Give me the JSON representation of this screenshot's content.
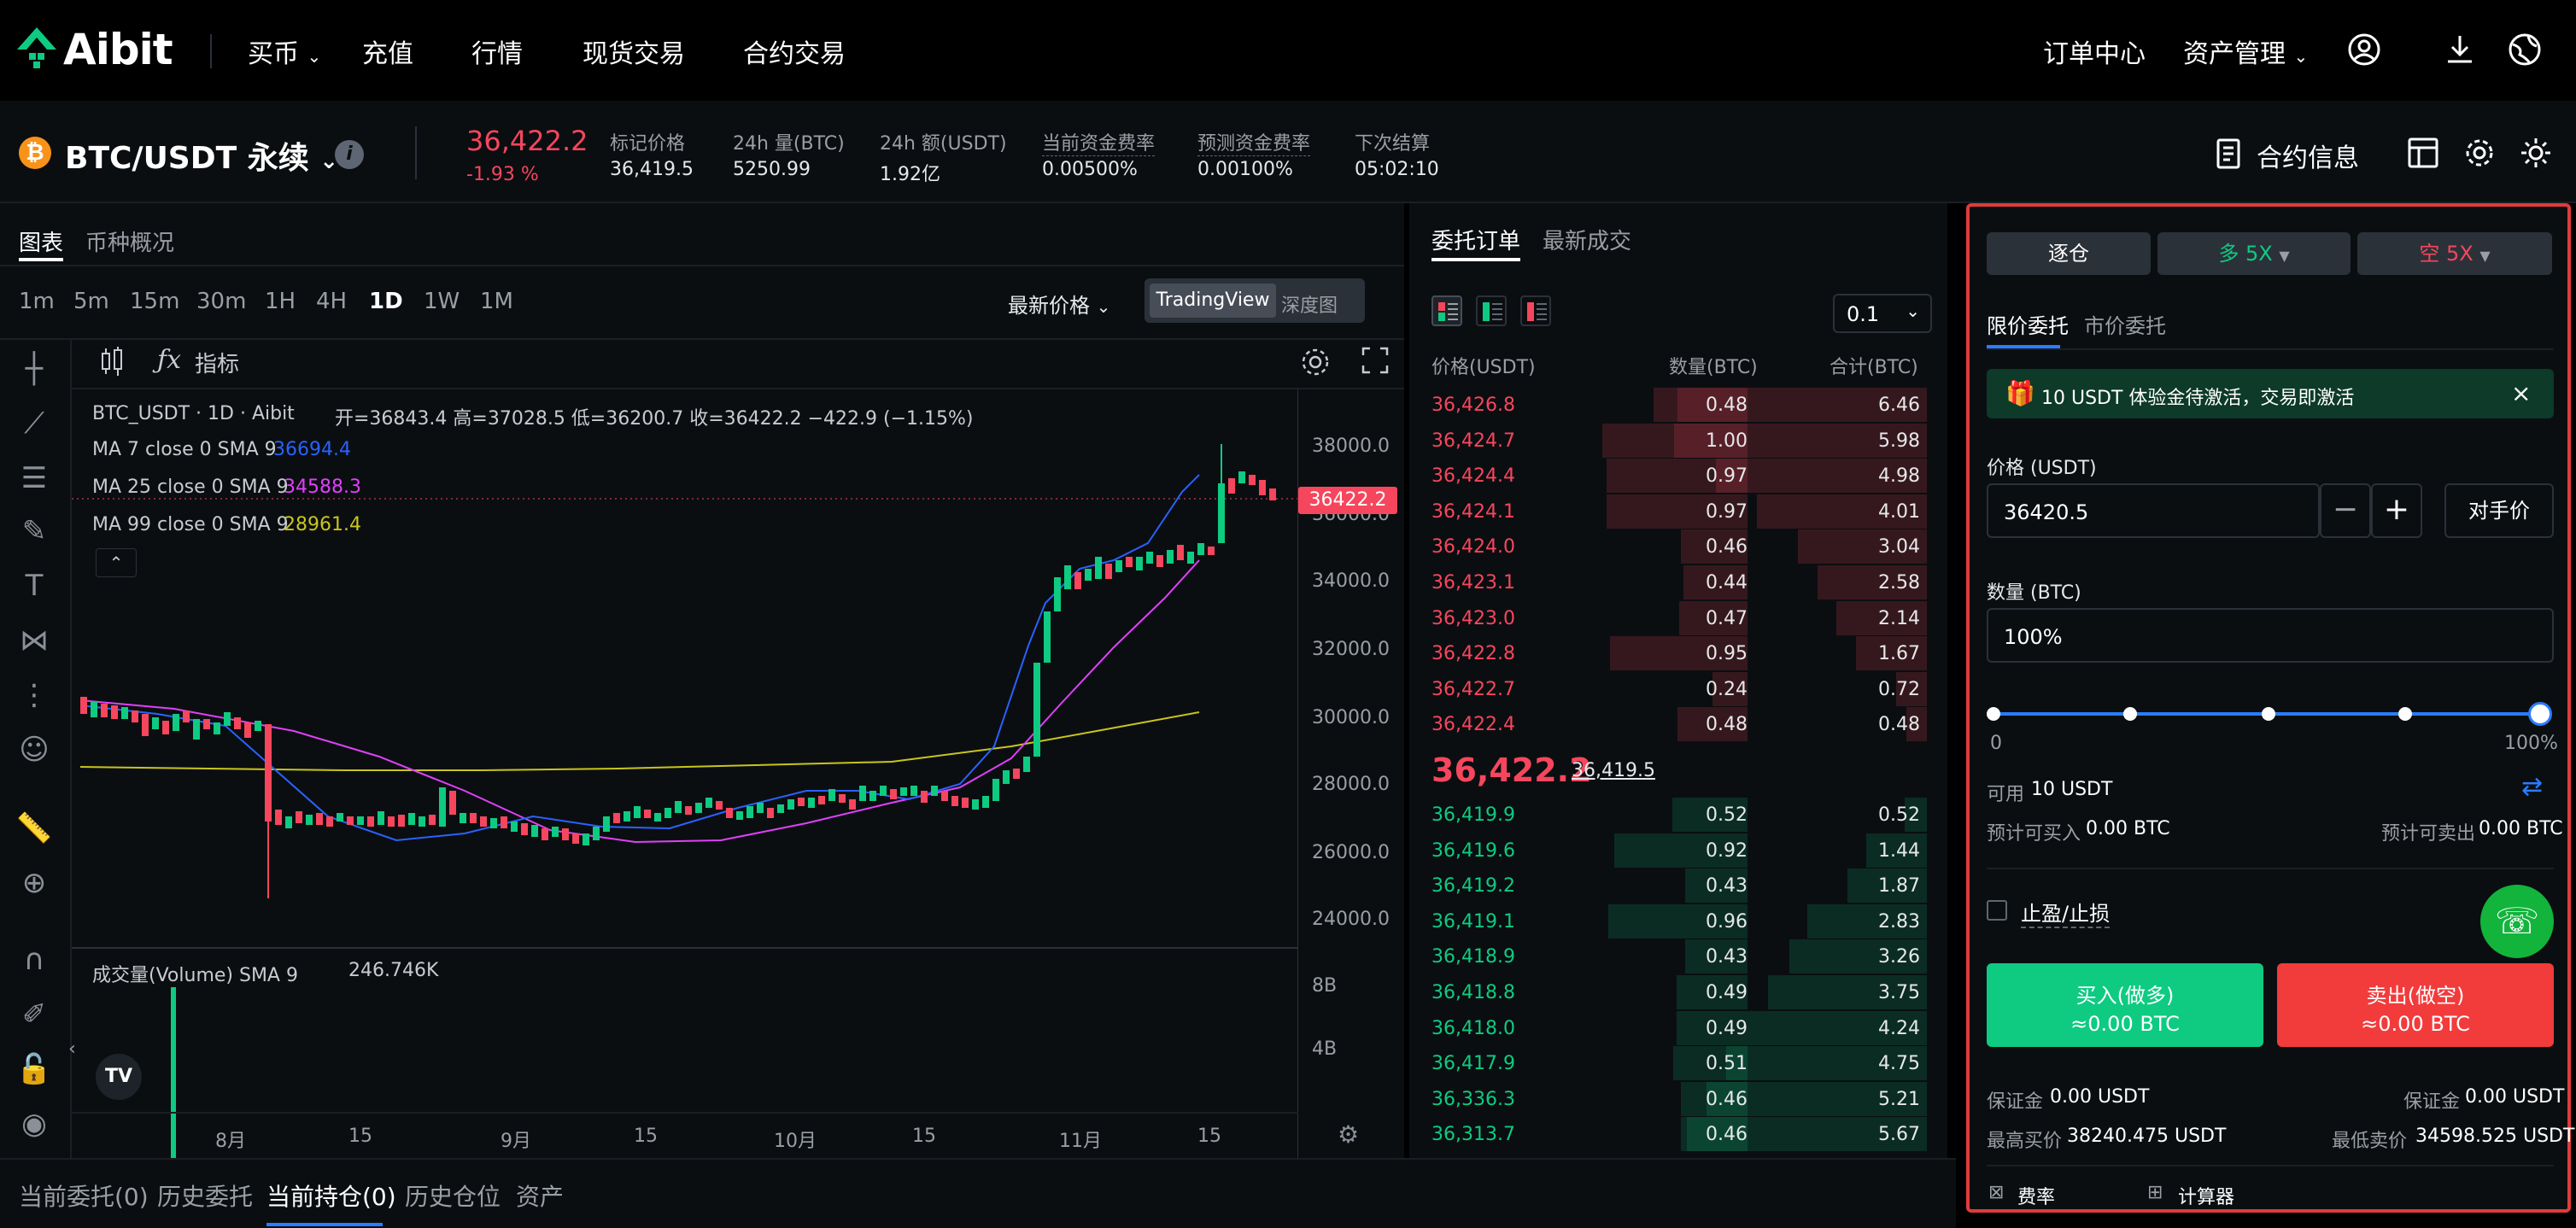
{
  "nav": {
    "logo": "Aibit",
    "items": [
      "买币",
      "充值",
      "行情",
      "现货交易",
      "合约交易"
    ],
    "right": [
      "订单中心",
      "资产管理"
    ]
  },
  "ticker": {
    "symbol": "BTC/USDT 永续",
    "price": "36,422.2",
    "change": "-1.93 %",
    "stats": [
      {
        "label": "标记价格",
        "value": "36,419.5"
      },
      {
        "label": "24h 量(BTC)",
        "value": "5250.99"
      },
      {
        "label": "24h 额(USDT)",
        "value": "1.92亿"
      },
      {
        "label": "当前资金费率",
        "value": "0.00500%"
      },
      {
        "label": "预测资金费率",
        "value": "0.00100%"
      },
      {
        "label": "下次结算",
        "value": "05:02:10"
      }
    ],
    "contract_info": "合约信息"
  },
  "chart": {
    "tabs": [
      "图表",
      "币种概况"
    ],
    "timeframes": [
      "1m",
      "5m",
      "15m",
      "30m",
      "1H",
      "4H",
      "1D",
      "1W",
      "1M"
    ],
    "active_tf": "1D",
    "price_type": "最新价格",
    "views": [
      "TradingView",
      "深度图"
    ],
    "indicators_label": "指标",
    "ohlc_title": "BTC_USDT · 1D · Aibit",
    "ohlc": "开=36843.4 高=37028.5 低=36200.7 收=36422.2 −422.9 (−1.15%)",
    "ma": [
      {
        "label": "MA 7 close 0 SMA 9",
        "value": "36694.4",
        "color": "#2962ff"
      },
      {
        "label": "MA 25 close 0 SMA 9",
        "value": "34588.3",
        "color": "#e040fb"
      },
      {
        "label": "MA 99 close 0 SMA 9",
        "value": "28961.4",
        "color": "#c9c51c"
      }
    ],
    "volume_label": "成交量(Volume) SMA 9",
    "volume_value": "246.746K",
    "price_tag": "36422.2",
    "y_ticks": [
      "38000.0",
      "36000.0",
      "34000.0",
      "32000.0",
      "30000.0",
      "28000.0",
      "26000.0",
      "24000.0"
    ],
    "vol_ticks": [
      "8B",
      "4B"
    ],
    "x_ticks": [
      "8月",
      "15",
      "9月",
      "15",
      "10月",
      "15",
      "11月",
      "15"
    ]
  },
  "orderbook": {
    "tabs": [
      "委托订单",
      "最新成交"
    ],
    "precision": "0.1",
    "headers": [
      "价格(USDT)",
      "数量(BTC)",
      "合计(BTC)"
    ],
    "asks": [
      [
        "36,426.8",
        "0.48",
        "6.46"
      ],
      [
        "36,424.7",
        "1.00",
        "5.98"
      ],
      [
        "36,424.4",
        "0.97",
        "4.98"
      ],
      [
        "36,424.1",
        "0.97",
        "4.01"
      ],
      [
        "36,424.0",
        "0.46",
        "3.04"
      ],
      [
        "36,423.1",
        "0.44",
        "2.58"
      ],
      [
        "36,423.0",
        "0.47",
        "2.14"
      ],
      [
        "36,422.8",
        "0.95",
        "1.67"
      ],
      [
        "36,422.7",
        "0.24",
        "0.72"
      ],
      [
        "36,422.4",
        "0.48",
        "0.48"
      ]
    ],
    "last_price": "36,422.2",
    "mark_price": "36,419.5",
    "bids": [
      [
        "36,419.9",
        "0.52",
        "0.52"
      ],
      [
        "36,419.6",
        "0.92",
        "1.44"
      ],
      [
        "36,419.2",
        "0.43",
        "1.87"
      ],
      [
        "36,419.1",
        "0.96",
        "2.83"
      ],
      [
        "36,418.9",
        "0.43",
        "3.26"
      ],
      [
        "36,418.8",
        "0.49",
        "3.75"
      ],
      [
        "36,418.0",
        "0.49",
        "4.24"
      ],
      [
        "36,417.9",
        "0.51",
        "4.75"
      ],
      [
        "36,336.3",
        "0.46",
        "5.21"
      ],
      [
        "36,313.7",
        "0.46",
        "5.67"
      ]
    ]
  },
  "trade": {
    "margin_mode": "逐仓",
    "long_lev": "多 5X",
    "short_lev": "空 5X",
    "order_tabs": [
      "限价委托",
      "市价委托"
    ],
    "promo": "10 USDT 体验金待激活，交易即激活",
    "price_label": "价格 (USDT)",
    "price_value": "36420.5",
    "counter_price": "对手价",
    "qty_label": "数量 (BTC)",
    "qty_value": "100%",
    "slider_min": "0",
    "slider_max": "100%",
    "slider_level": 1.0,
    "available_label": "可用",
    "available_value": "10 USDT",
    "est_buy_label": "预计可买入",
    "est_buy_value": "0.00 BTC",
    "est_sell_label": "预计可卖出",
    "est_sell_value": "0.00 BTC",
    "tpsl": "止盈/止损",
    "buy_label": "买入(做多)",
    "buy_sub": "≈0.00 BTC",
    "sell_label": "卖出(做空)",
    "sell_sub": "≈0.00 BTC",
    "margin_label": "保证金",
    "margin_buy": "0.00 USDT",
    "margin_sell": "0.00 USDT",
    "max_buy_label": "最高买价",
    "max_buy": "38240.475 USDT",
    "min_sell_label": "最低卖价",
    "min_sell": "34598.525 USDT",
    "fee_label": "费率",
    "calc_label": "计算器"
  },
  "bottom_tabs": [
    "当前委托(0)",
    "历史委托",
    "当前持仓(0)",
    "历史仓位",
    "资产"
  ],
  "colors": {
    "up": "#0ecb81",
    "down": "#f6465d",
    "accent_border": "#e13b3b"
  }
}
